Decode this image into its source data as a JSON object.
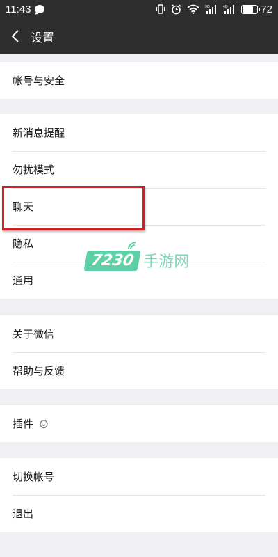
{
  "status_bar": {
    "time": "11:43",
    "battery": "72",
    "battery_level": 0.72,
    "network_labels": [
      "3G",
      "4G"
    ]
  },
  "nav": {
    "title": "设置"
  },
  "groups": {
    "account": [
      "帐号与安全"
    ],
    "general": [
      "新消息提醒",
      "勿扰模式",
      "聊天",
      "隐私",
      "通用"
    ],
    "about": [
      "关于微信",
      "帮助与反馈"
    ],
    "plugins": [
      "插件"
    ],
    "session": [
      "切换帐号",
      "退出"
    ]
  },
  "watermark": {
    "number": "7230",
    "text": "手游网"
  },
  "colors": {
    "header_bg": "#2e2e2e",
    "page_bg": "#efeff4",
    "highlight": "#d31f25",
    "watermark": "#5fd0a6"
  }
}
